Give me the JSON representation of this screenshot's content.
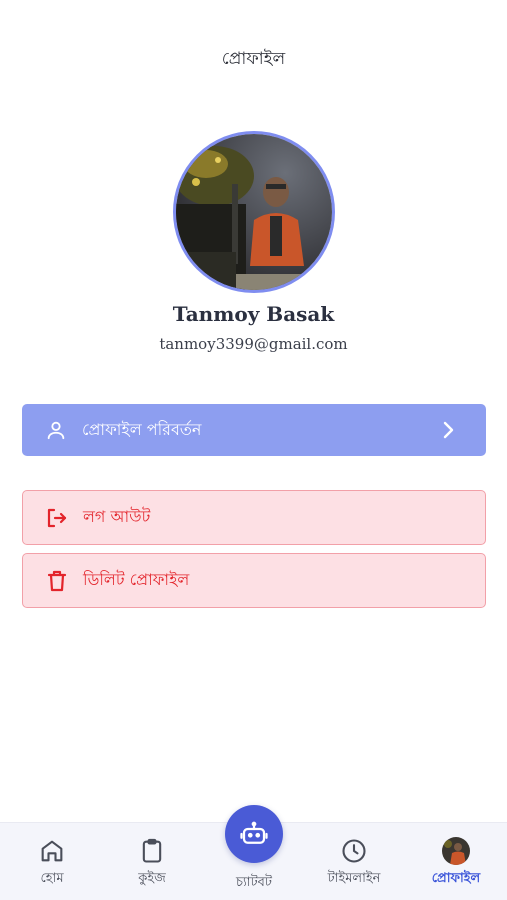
{
  "header": {
    "title": "প্রোফাইল"
  },
  "profile": {
    "name": "Tanmoy Basak",
    "email": "tanmoy3399@gmail.com",
    "avatar_icon": "user-photo"
  },
  "actions": {
    "edit_label": "প্রোফাইল পরিবর্তন",
    "logout_label": "লগ আউট",
    "delete_label": "ডিলিট প্রোফাইল"
  },
  "nav": {
    "home": "হোম",
    "quiz": "কুইজ",
    "chatbot": "চ্যাটবট",
    "timeline": "টাইমলাইন",
    "profile": "প্রোফাইল",
    "active": "profile"
  },
  "colors": {
    "accent": "#4a5bd6",
    "edit_bg": "#8d9ef0",
    "danger": "#e3242b",
    "danger_bg": "#fde0e4"
  }
}
